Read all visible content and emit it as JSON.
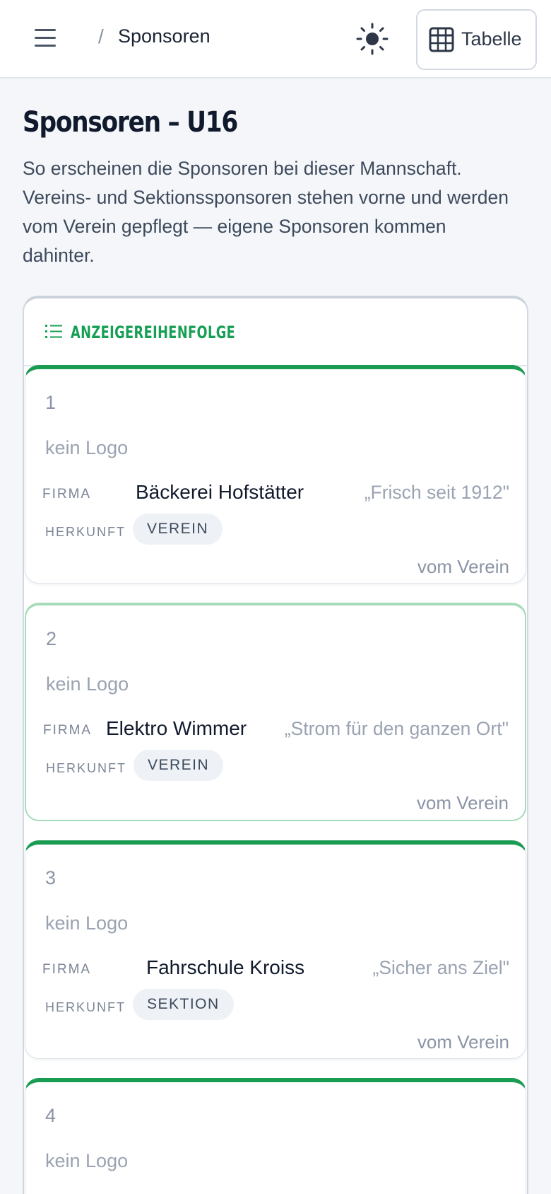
{
  "header": {
    "breadcrumb_sep": "/",
    "breadcrumb_current": "Sponsoren",
    "theme_icon": "sun-icon",
    "table_button_label": "Tabelle",
    "table_icon": "table-icon"
  },
  "page": {
    "title": "Sponsoren – U16",
    "description": "So erscheinen die Sponsoren bei dieser Mannschaft. Vereins- und Sektionssponsoren stehen vorne und werden vom Verein gepflegt — eigene Sponsoren kommen dahinter."
  },
  "panel": {
    "title": "ANZEIGEREIHENFOLGE",
    "icon": "list-icon"
  },
  "labels": {
    "firma": "FIRMA",
    "herkunft": "HERKUNFT"
  },
  "sponsors": [
    {
      "rank": "1",
      "logo": "kein Logo",
      "name": "Bäckerei Hofstätter",
      "slogan": "„Frisch seit 1912\"",
      "origin": "VEREIN",
      "managed": "vom Verein"
    },
    {
      "rank": "2",
      "logo": "kein Logo",
      "name": "Elektro Wimmer",
      "slogan": "„Strom für den ganzen Ort\"",
      "origin": "VEREIN",
      "managed": "vom Verein"
    },
    {
      "rank": "3",
      "logo": "kein Logo",
      "name": "Fahrschule Kroiss",
      "slogan": "„Sicher ans Ziel\"",
      "origin": "SEKTION",
      "managed": "vom Verein"
    },
    {
      "rank": "4",
      "logo": "kein Logo"
    }
  ],
  "colors": {
    "accent_green": "#1a9c52",
    "selected_border": "#a6dbb9"
  }
}
